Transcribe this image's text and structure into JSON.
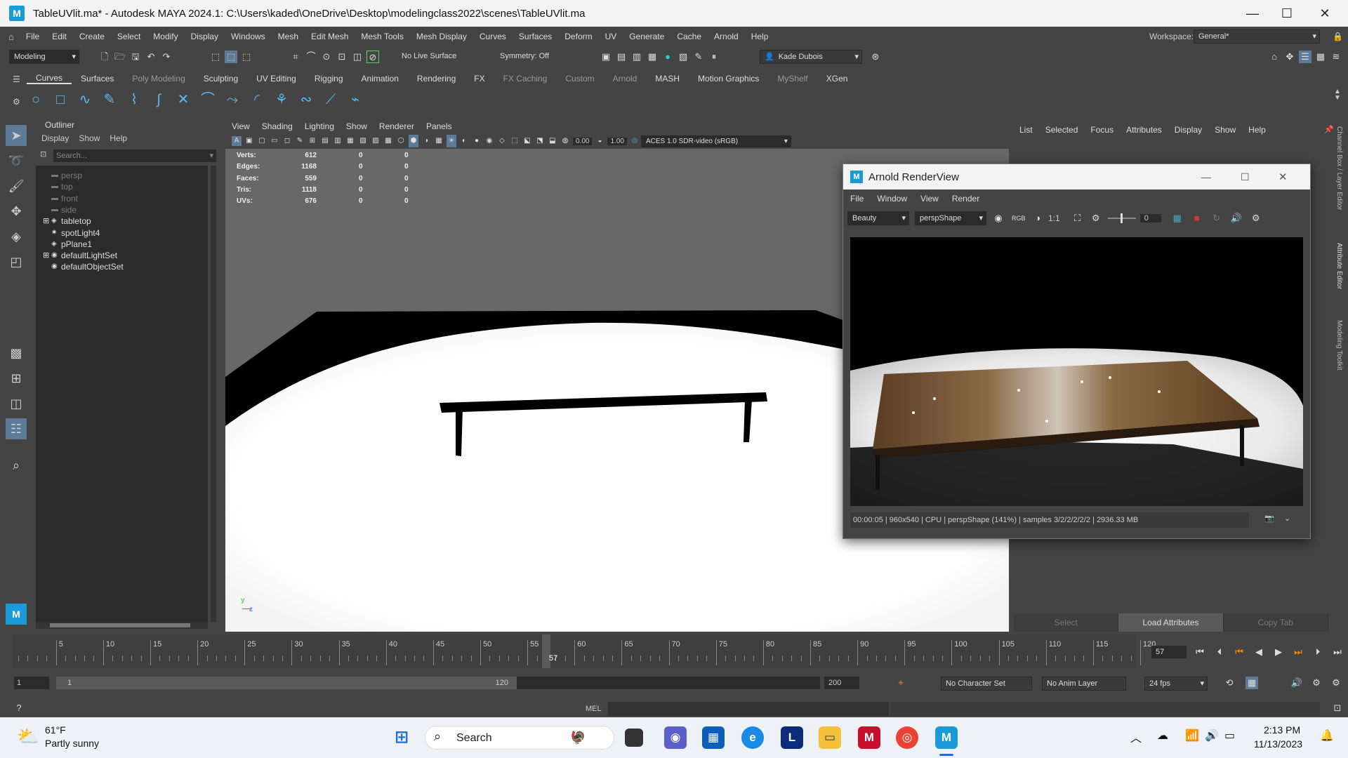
{
  "window": {
    "title": "TableUVlit.ma* - Autodesk MAYA 2024.1: C:\\Users\\kaded\\OneDrive\\Desktop\\modelingclass2022\\scenes\\TableUVlit.ma",
    "logo": "M"
  },
  "menu": [
    "File",
    "Edit",
    "Create",
    "Select",
    "Modify",
    "Display",
    "Windows",
    "Mesh",
    "Edit Mesh",
    "Mesh Tools",
    "Mesh Display",
    "Curves",
    "Surfaces",
    "Deform",
    "UV",
    "Generate",
    "Cache",
    "Arnold",
    "Help"
  ],
  "workspace": {
    "label": "Workspace:",
    "value": "General*"
  },
  "status": {
    "mode": "Modeling",
    "live_surface": "No Live Surface",
    "symmetry": "Symmetry: Off",
    "user": "Kade Dubois"
  },
  "shelf_tabs": [
    "Curves",
    "Surfaces",
    "Poly Modeling",
    "Sculpting",
    "UV Editing",
    "Rigging",
    "Animation",
    "Rendering",
    "FX",
    "FX Caching",
    "Custom",
    "Arnold",
    "MASH",
    "Motion Graphics",
    "MyShelf",
    "XGen"
  ],
  "shelf_dim": [
    2,
    9,
    10,
    11,
    14
  ],
  "outliner": {
    "title": "Outliner",
    "menu": [
      "Display",
      "Show",
      "Help"
    ],
    "search_placeholder": "Search...",
    "items": [
      {
        "label": "persp",
        "dim": true,
        "icon": "camera-icon"
      },
      {
        "label": "top",
        "dim": true,
        "icon": "camera-icon"
      },
      {
        "label": "front",
        "dim": true,
        "icon": "camera-icon"
      },
      {
        "label": "side",
        "dim": true,
        "icon": "camera-icon"
      },
      {
        "label": "tabletop",
        "dim": false,
        "icon": "mesh-icon",
        "expand": true
      },
      {
        "label": "spotLight4",
        "dim": false,
        "icon": "spotlight-icon"
      },
      {
        "label": "pPlane1",
        "dim": false,
        "icon": "mesh-icon"
      },
      {
        "label": "defaultLightSet",
        "dim": false,
        "icon": "set-icon",
        "expand": true
      },
      {
        "label": "defaultObjectSet",
        "dim": false,
        "icon": "set-icon"
      }
    ]
  },
  "viewport": {
    "menu": [
      "View",
      "Shading",
      "Lighting",
      "Show",
      "Renderer",
      "Panels"
    ],
    "near": "0.00",
    "far": "1.00",
    "colorspace": "ACES 1.0 SDR-video (sRGB)",
    "hud": [
      {
        "label": "Verts:",
        "a": "612",
        "b": "0",
        "c": "0"
      },
      {
        "label": "Edges:",
        "a": "1168",
        "b": "0",
        "c": "0"
      },
      {
        "label": "Faces:",
        "a": "559",
        "b": "0",
        "c": "0"
      },
      {
        "label": "Tris:",
        "a": "1118",
        "b": "0",
        "c": "0"
      },
      {
        "label": "UVs:",
        "a": "676",
        "b": "0",
        "c": "0"
      }
    ],
    "axis_y": "y",
    "axis_z": "z"
  },
  "channel_box": {
    "menu": [
      "List",
      "Selected",
      "Focus",
      "Attributes",
      "Display",
      "Show",
      "Help"
    ],
    "buttons": [
      "Select",
      "Load Attributes",
      "Copy Tab"
    ],
    "side_tabs": [
      "Channel Box / Layer Editor",
      "Attribute Editor",
      "Modeling Toolkit"
    ]
  },
  "renderview": {
    "title": "Arnold RenderView",
    "menu": [
      "File",
      "Window",
      "View",
      "Render"
    ],
    "aov": "Beauty",
    "camera": "perspShape",
    "ratio": "1:1",
    "exposure": "0",
    "status": "00:00:05 | 960x540 | CPU | perspShape (141%) | samples 3/2/2/2/2/2 | 2936.33 MB"
  },
  "timeline": {
    "ticks": [
      "5",
      "10",
      "15",
      "20",
      "25",
      "30",
      "35",
      "40",
      "45",
      "50",
      "55",
      "60",
      "65",
      "70",
      "75",
      "80",
      "85",
      "90",
      "95",
      "100",
      "105",
      "110",
      "115",
      "120"
    ],
    "current": "57",
    "current_field": "57"
  },
  "range": {
    "start": "1",
    "inner_start": "1",
    "inner_end": "120",
    "end": "200",
    "char_set": "No Character Set",
    "anim_layer": "No Anim Layer",
    "fps": "24 fps"
  },
  "cmd": {
    "lang": "MEL"
  },
  "taskbar": {
    "temp": "61°F",
    "weather": "Partly sunny",
    "search": "Search",
    "time": "2:13 PM",
    "date": "11/13/2023"
  }
}
